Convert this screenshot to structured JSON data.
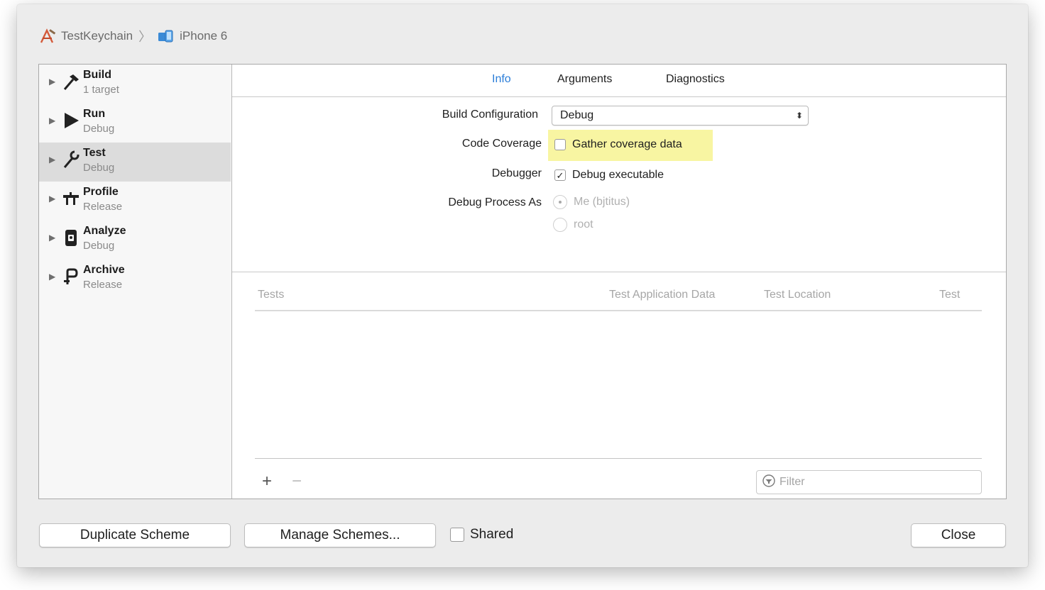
{
  "breadcrumb": {
    "project": "TestKeychain",
    "device": "iPhone 6"
  },
  "sidebar": {
    "items": [
      {
        "name": "Build",
        "sub": "1 target",
        "icon": "hammer-icon"
      },
      {
        "name": "Run",
        "sub": "Debug",
        "icon": "play-icon"
      },
      {
        "name": "Test",
        "sub": "Debug",
        "icon": "wrench-icon",
        "selected": true
      },
      {
        "name": "Profile",
        "sub": "Release",
        "icon": "profile-tools-icon"
      },
      {
        "name": "Analyze",
        "sub": "Debug",
        "icon": "analyze-icon"
      },
      {
        "name": "Archive",
        "sub": "Release",
        "icon": "archive-icon"
      }
    ]
  },
  "tabs": {
    "info": "Info",
    "arguments": "Arguments",
    "diagnostics": "Diagnostics",
    "active": "Info"
  },
  "form": {
    "build_configuration_label": "Build Configuration",
    "build_configuration_value": "Debug",
    "code_coverage_label": "Code Coverage",
    "gather_coverage_label": "Gather coverage data",
    "gather_coverage_checked": false,
    "debugger_label": "Debugger",
    "debug_executable_label": "Debug executable",
    "debug_executable_checked": true,
    "debug_process_as_label": "Debug Process As",
    "radio_me": "Me (bjtitus)",
    "radio_root": "root",
    "radio_selected": "Me (bjtitus)"
  },
  "table": {
    "columns": [
      "Tests",
      "Test Application Data",
      "Test Location",
      "Test"
    ]
  },
  "filter": {
    "placeholder": "Filter"
  },
  "buttons": {
    "duplicate": "Duplicate Scheme",
    "manage": "Manage Schemes...",
    "shared": "Shared",
    "shared_checked": false,
    "close": "Close"
  },
  "colors": {
    "accent": "#2a7dd8",
    "highlight": "#f8f5a2",
    "selected_row": "#dcdcdc"
  }
}
